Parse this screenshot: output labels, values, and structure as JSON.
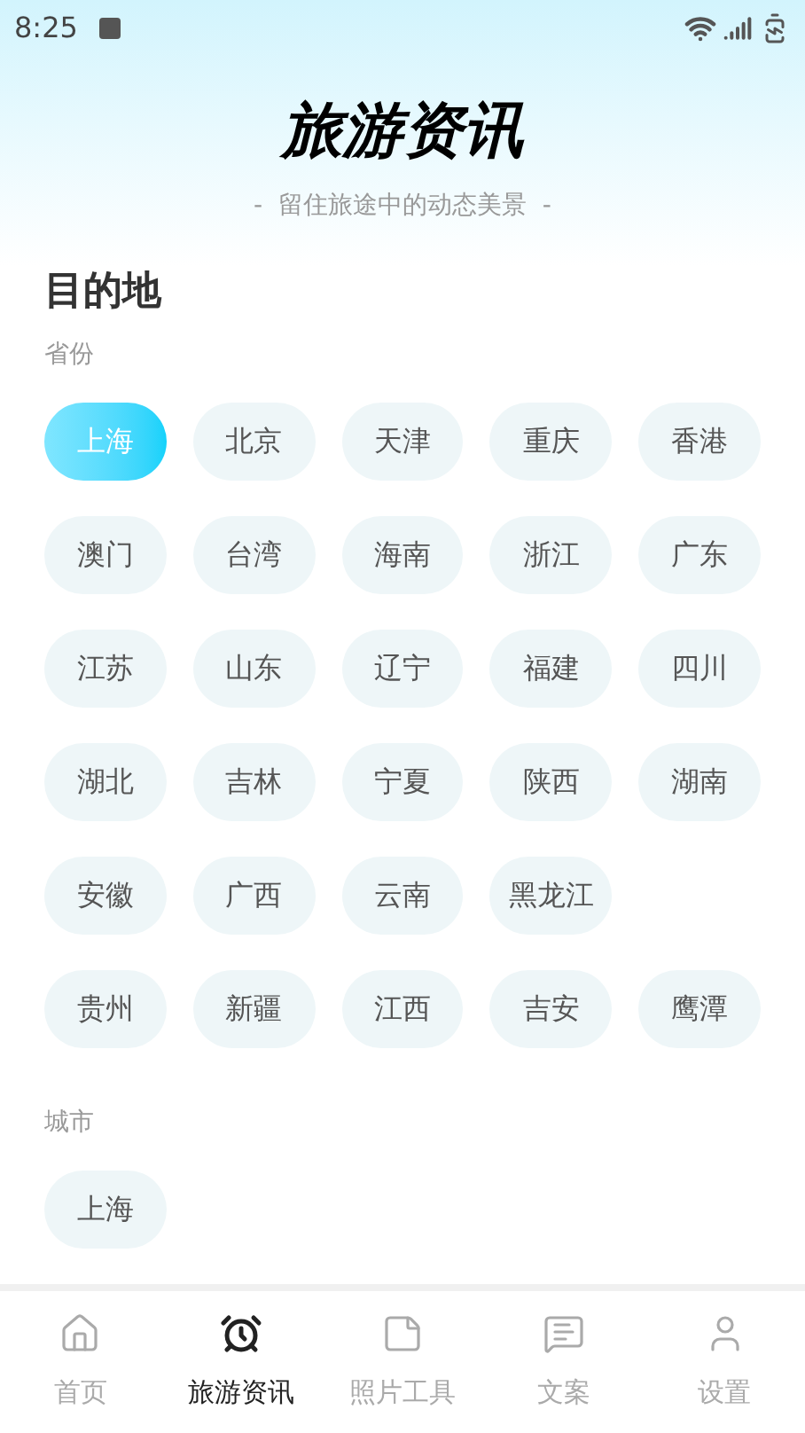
{
  "status_bar": {
    "time": "8:25"
  },
  "header": {
    "title": "旅游资讯",
    "subtitle": "-  留住旅途中的动态美景  -"
  },
  "section_title": "目的地",
  "provinces": {
    "label": "省份",
    "rows": [
      [
        {
          "label": "上海",
          "selected": true
        },
        {
          "label": "北京",
          "selected": false
        },
        {
          "label": "天津",
          "selected": false
        },
        {
          "label": "重庆",
          "selected": false
        },
        {
          "label": "香港",
          "selected": false
        }
      ],
      [
        {
          "label": "澳门",
          "selected": false
        },
        {
          "label": "台湾",
          "selected": false
        },
        {
          "label": "海南",
          "selected": false
        },
        {
          "label": "浙江",
          "selected": false
        },
        {
          "label": "广东",
          "selected": false
        }
      ],
      [
        {
          "label": "江苏",
          "selected": false
        },
        {
          "label": "山东",
          "selected": false
        },
        {
          "label": "辽宁",
          "selected": false
        },
        {
          "label": "福建",
          "selected": false
        },
        {
          "label": "四川",
          "selected": false
        }
      ],
      [
        {
          "label": "湖北",
          "selected": false
        },
        {
          "label": "吉林",
          "selected": false
        },
        {
          "label": "宁夏",
          "selected": false
        },
        {
          "label": "陕西",
          "selected": false
        },
        {
          "label": "湖南",
          "selected": false
        }
      ],
      [
        {
          "label": "安徽",
          "selected": false
        },
        {
          "label": "广西",
          "selected": false
        },
        {
          "label": "云南",
          "selected": false
        },
        {
          "label": "黑龙江",
          "selected": false
        }
      ],
      [
        {
          "label": "贵州",
          "selected": false
        },
        {
          "label": "新疆",
          "selected": false
        },
        {
          "label": "江西",
          "selected": false
        },
        {
          "label": "吉安",
          "selected": false
        },
        {
          "label": "鹰潭",
          "selected": false
        }
      ]
    ]
  },
  "cities": {
    "label": "城市",
    "rows": [
      [
        {
          "label": "上海",
          "selected": false
        }
      ]
    ]
  },
  "tab_bar": [
    {
      "kind": "home",
      "label": "首页",
      "selected": false
    },
    {
      "kind": "alarm",
      "label": "旅游资讯",
      "selected": true
    },
    {
      "kind": "note",
      "label": "照片工具",
      "selected": false
    },
    {
      "kind": "message",
      "label": "文案",
      "selected": false
    },
    {
      "kind": "user",
      "label": "设置",
      "selected": false
    }
  ]
}
